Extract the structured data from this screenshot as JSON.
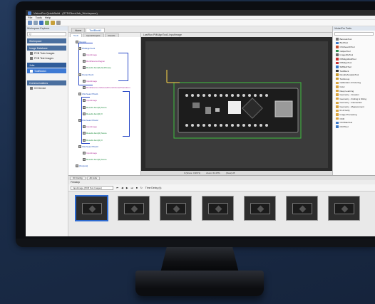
{
  "app": {
    "title_prefix": "VisionPro QuickBuild",
    "title_file": "(STDClientJob_Workspace)"
  },
  "menu": [
    "File",
    "Tools",
    "Help"
  ],
  "left_panel": {
    "header": "Workspace Explorer",
    "search_placeholder": "Q",
    "sections": [
      {
        "label": "Workspace"
      },
      {
        "label": "Image Database"
      },
      {
        "label": "Jobs"
      },
      {
        "label": "Communications"
      }
    ],
    "image_items": [
      "PCB Train Images",
      "PCB Test Images"
    ],
    "job_item": "ToolBlock1",
    "comm_item": "I/O Device"
  },
  "center_tabs": [
    {
      "label": "Home"
    },
    {
      "label": "ToolBlock1"
    }
  ],
  "graph_tabs": [
    "Tools",
    "Inputs/Outputs",
    "Results"
  ],
  "graph_nodes": [
    {
      "label": "[Inputs]",
      "color": "blue"
    },
    {
      "label": "PMAlignTool1",
      "color": "blue"
    },
    {
      "label": "InputImage",
      "color": "magenta"
    },
    {
      "label": "RunParams.Region",
      "color": "magenta"
    },
    {
      "label": "Results.Item[0].GetPose()",
      "color": "green"
    },
    {
      "label": "FixtureTool1",
      "color": "blue"
    },
    {
      "label": "InputImage",
      "color": "magenta"
    },
    {
      "label": "RunParams.UnfixturedFromFixturedTransform",
      "color": "magenta"
    },
    {
      "label": "CNLSearchTool1",
      "color": "blue"
    },
    {
      "label": "InputImage",
      "color": "magenta"
    },
    {
      "label": "Results.Item[0].Score",
      "color": "green"
    },
    {
      "label": "Results.Item[0].X",
      "color": "green"
    },
    {
      "label": "CNLSearchTool2",
      "color": "blue"
    },
    {
      "label": "InputImage",
      "color": "magenta"
    },
    {
      "label": "Results.Item[0].Score",
      "color": "green"
    },
    {
      "label": "Results.Item[0].X",
      "color": "green"
    },
    {
      "label": "CNLSearchTool3",
      "color": "blue"
    },
    {
      "label": "InputImage",
      "color": "magenta"
    },
    {
      "label": "Results.Item[0].Score",
      "color": "green"
    },
    {
      "label": "[Outputs]",
      "color": "blue"
    }
  ],
  "view": {
    "header": "LastRun.PMAlignTool1.InputImage",
    "status": [
      "0 (Score: 0.9971)",
      "Zoom: 64.07%",
      "(View) 28"
    ]
  },
  "toolbox": {
    "header": "VisionPro Tools",
    "items": [
      {
        "label": "BarcodeTool",
        "color": "#7a7a7a"
      },
      {
        "label": "BlobTool",
        "color": "#3a78c8"
      },
      {
        "label": "CNLSearchTool",
        "color": "#c84f2f"
      },
      {
        "label": "CaliperTool",
        "color": "#2f8f4f"
      },
      {
        "label": "ImageFileTool",
        "color": "#6a6a6a"
      },
      {
        "label": "PMAlignMultiTool",
        "color": "#c8302f"
      },
      {
        "label": "PMAlignTool",
        "color": "#c8302f"
      },
      {
        "label": "SMMultiTool",
        "color": "#3a78c8"
      },
      {
        "label": "ToolBlock",
        "color": "#3a3a3a"
      },
      {
        "label": "ResultsAnalysisTool",
        "color": "#c89a2f"
      },
      {
        "label": "ToolGroup",
        "color": "#c89a2f"
      },
      {
        "label": "Calibration & Fixturing",
        "color": "#d9a441"
      },
      {
        "label": "Color",
        "color": "#d9a441"
      },
      {
        "label": "Deep Learning",
        "color": "#d9a441"
      },
      {
        "label": "Geometry - Creation",
        "color": "#d9a441"
      },
      {
        "label": "Geometry - Finding & Fitting",
        "color": "#d9a441"
      },
      {
        "label": "Geometry - Intersection",
        "color": "#d9a441"
      },
      {
        "label": "Geometry - Measurement",
        "color": "#d9a441"
      },
      {
        "label": "ID & Verify",
        "color": "#d9a441"
      },
      {
        "label": "Image Processing",
        "color": "#d9a441"
      },
      {
        "label": "OCR",
        "color": "#d9a441"
      },
      {
        "label": "OCVMaxTool",
        "color": "#3a78c8"
      },
      {
        "label": "OCVTool",
        "color": "#3a78c8"
      }
    ]
  },
  "bottom_tabs": [
    "I/O Config",
    "All Jobs"
  ],
  "filmstrip": {
    "header": "Filmstrip",
    "select_value": "InputImage (PCB Test Images)",
    "counter": "Time Delay (s)",
    "thumb_count": 7
  }
}
